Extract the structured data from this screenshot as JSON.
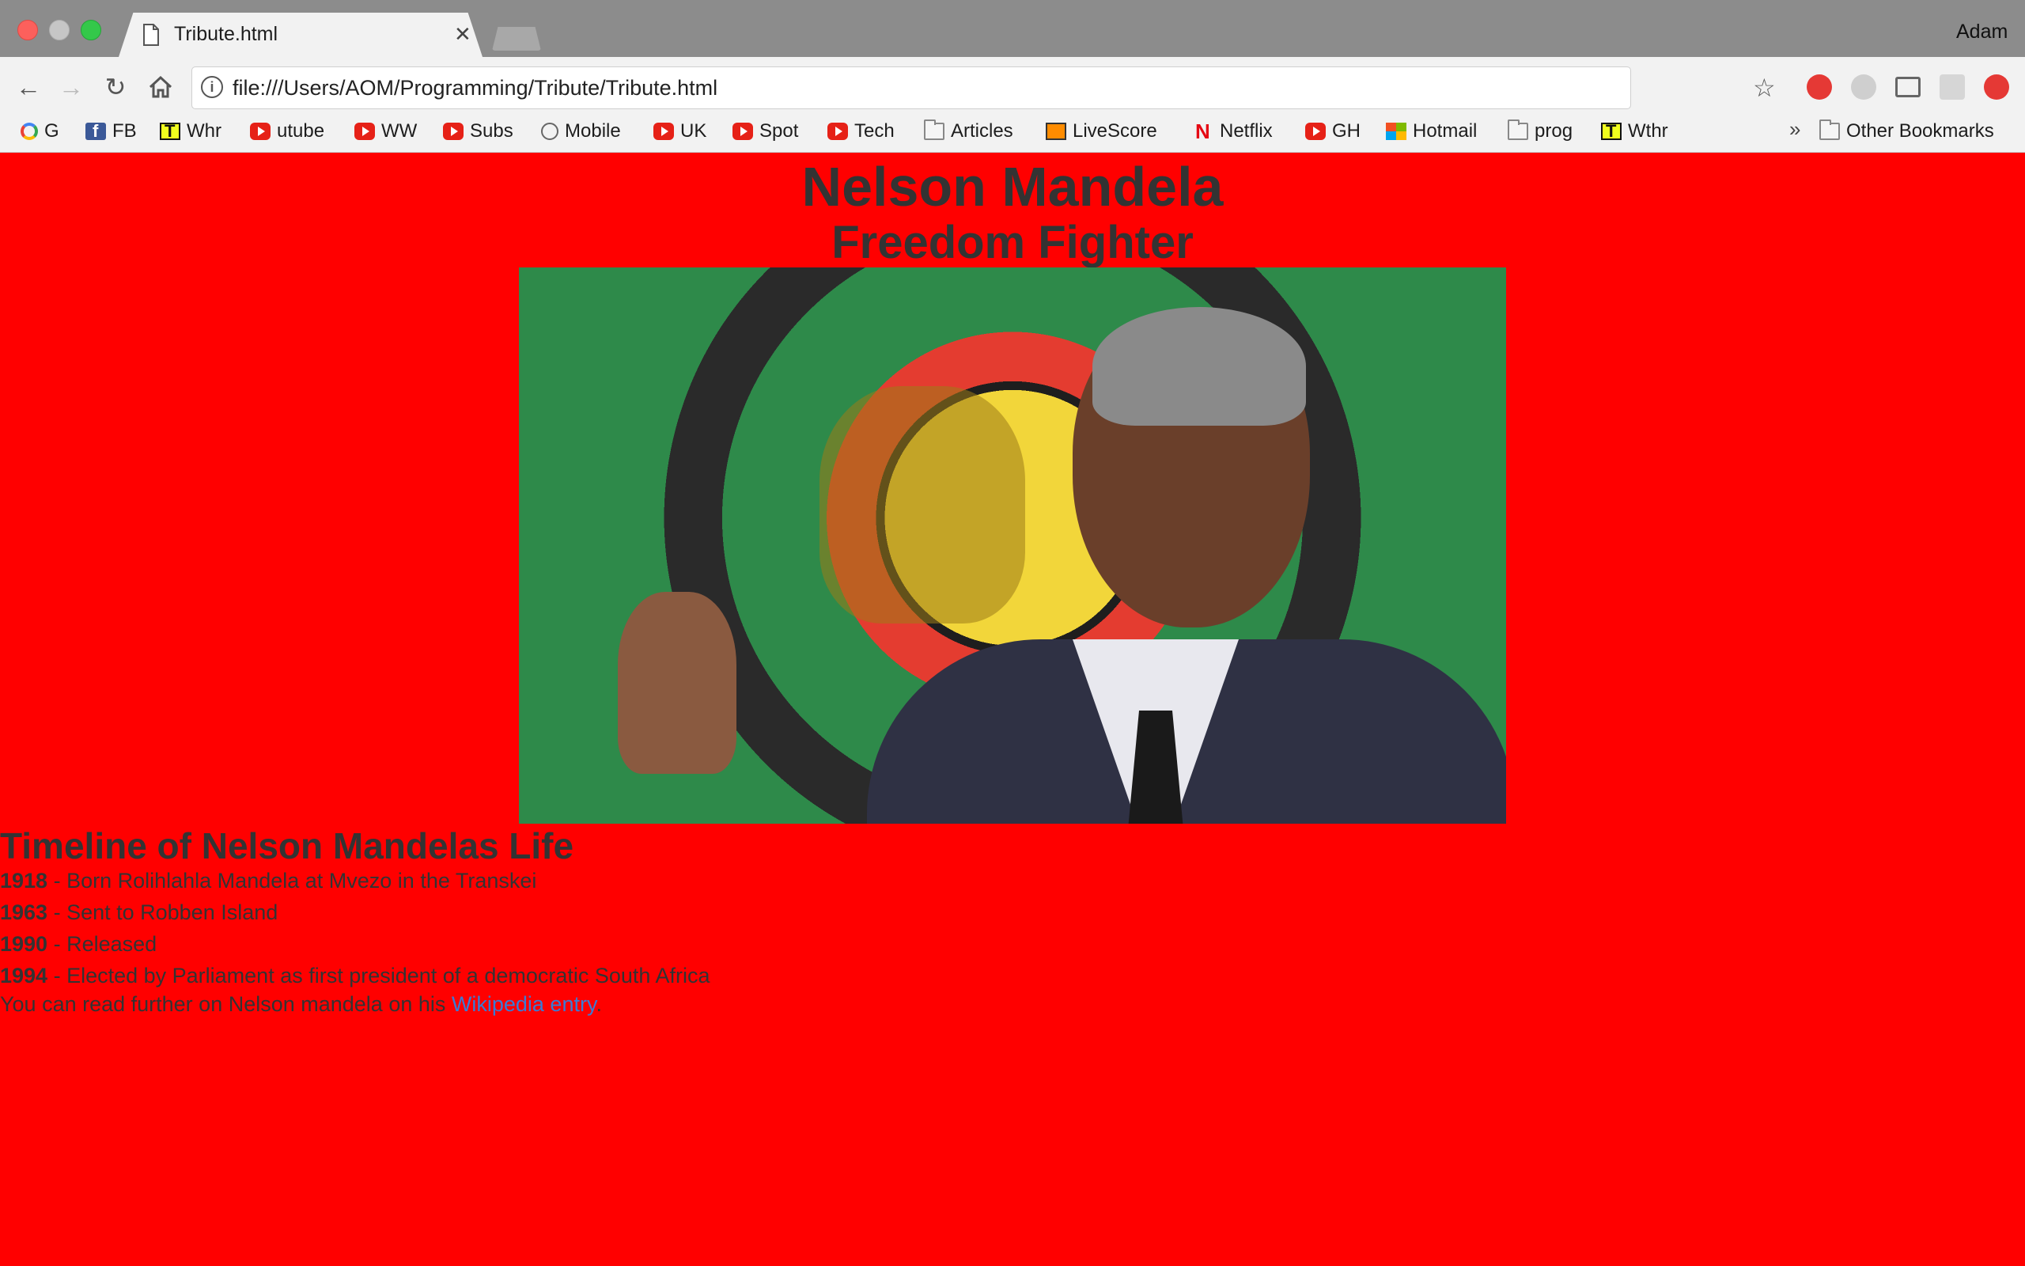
{
  "browser": {
    "tab_title": "Tribute.html",
    "profile_name": "Adam",
    "url": "file:///Users/AOM/Programming/Tribute/Tribute.html",
    "bookmarks": [
      {
        "label": "G",
        "icon": "google-icon"
      },
      {
        "label": "FB",
        "icon": "facebook-icon"
      },
      {
        "label": "Whr",
        "icon": "t-icon"
      },
      {
        "label": "utube",
        "icon": "youtube-icon"
      },
      {
        "label": "WW",
        "icon": "youtube-icon"
      },
      {
        "label": "Subs",
        "icon": "youtube-icon"
      },
      {
        "label": "Mobile",
        "icon": "history-icon"
      },
      {
        "label": "UK",
        "icon": "youtube-icon"
      },
      {
        "label": "Spot",
        "icon": "youtube-icon"
      },
      {
        "label": "Tech",
        "icon": "youtube-icon"
      },
      {
        "label": "Articles",
        "icon": "folder-icon"
      },
      {
        "label": "LiveScore",
        "icon": "livescore-icon"
      },
      {
        "label": "Netflix",
        "icon": "netflix-icon"
      },
      {
        "label": "GH",
        "icon": "youtube-icon"
      },
      {
        "label": "Hotmail",
        "icon": "microsoft-icon"
      },
      {
        "label": "prog",
        "icon": "folder-icon"
      },
      {
        "label": "Wthr",
        "icon": "t-icon"
      }
    ],
    "other_bookmarks": "Other Bookmarks",
    "overflow_chevron": "»"
  },
  "page": {
    "background_color": "#ff0000",
    "title": "Nelson Mandela",
    "subtitle": "Freedom Fighter",
    "timeline_heading": "Timeline of Nelson Mandelas Life",
    "events": [
      {
        "year": "1918",
        "text": " - Born Rolihlahla Mandela at Mvezo in the Transkei"
      },
      {
        "year": "1963",
        "text": " - Sent to Robben Island"
      },
      {
        "year": "1990",
        "text": " - Released"
      },
      {
        "year": "1994",
        "text": " - Elected by Parliament as first president of a democratic South Africa"
      }
    ],
    "further_text": "You can read further on Nelson mandela on his ",
    "link_text": "Wikipedia entry",
    "further_end": "."
  }
}
